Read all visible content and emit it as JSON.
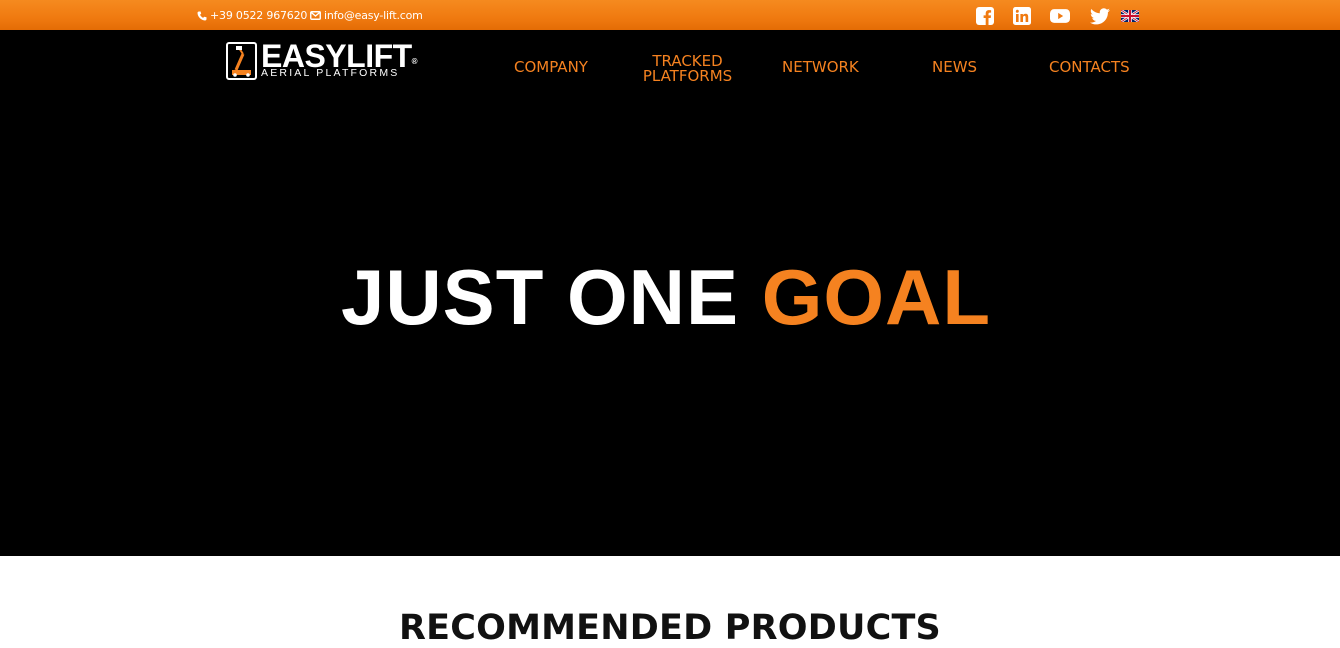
{
  "topbar": {
    "phone": "+39 0522 967620",
    "email": "info@easy-lift.com",
    "social": [
      "facebook-icon",
      "linkedin-icon",
      "youtube-icon",
      "twitter-icon"
    ],
    "language_flag": "uk-flag-icon"
  },
  "brand": {
    "name": "EASYLIFT",
    "registered": "®",
    "tagline": "AERIAL PLATFORMS"
  },
  "nav": {
    "company": "COMPANY",
    "tracked_platforms": "TRACKED PLATFORMS",
    "network": "NETWORK",
    "news": "NEWS",
    "contacts": "CONTACTS"
  },
  "hero": {
    "title_part1": "JUST ONE",
    "title_part2": "GOAL"
  },
  "section": {
    "title": "RECOMMENDED PRODUCTS"
  },
  "colors": {
    "accent": "#f58220",
    "topbar": "#f07a10",
    "header_bg": "#000000",
    "text_dark": "#111111"
  }
}
